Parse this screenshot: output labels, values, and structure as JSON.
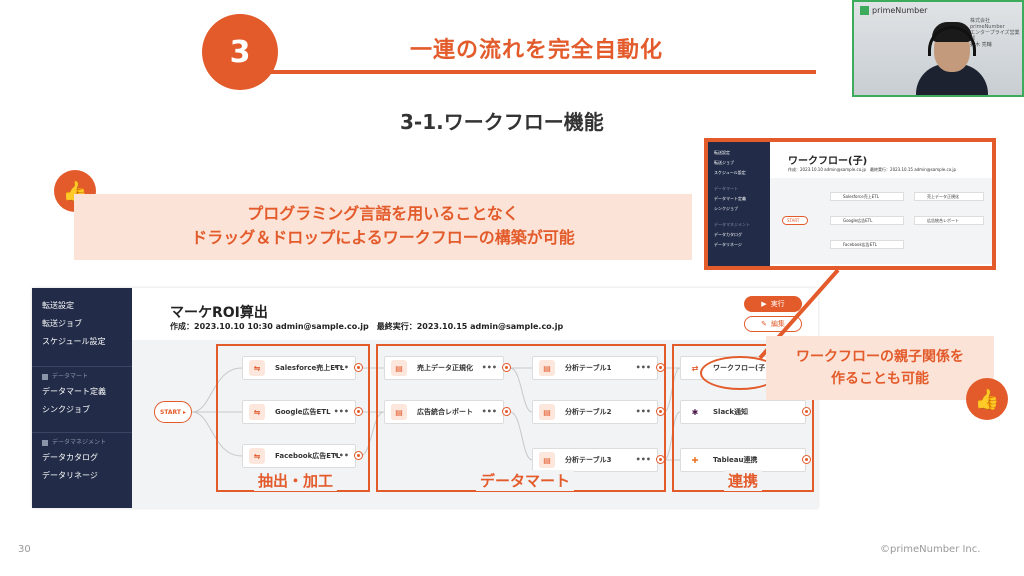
{
  "header": {
    "step_number": "3",
    "step_title": "一連の流れを完全自動化",
    "subtitle": "3-1.ワークフロー機能"
  },
  "video": {
    "logo_text": "primeNumber",
    "nametag": [
      "株式会社primeNumber",
      "エンタープライズ営業部",
      "鈴木 亮輔"
    ]
  },
  "banner": {
    "line1": "プログラミング言語を用いることなく",
    "line2": "ドラッグ＆ドロップによるワークフローの構築が可能"
  },
  "callout": {
    "line1": "ワークフローの親子関係を",
    "line2": "作ることも可能"
  },
  "preview": {
    "sidebar": [
      "転送設定",
      "転送ジョブ",
      "スケジュール設定",
      "データマート",
      "データマート定義",
      "シンクジョブ",
      "データマネジメント",
      "データカタログ",
      "データリネージ"
    ],
    "title": "ワークフロー(子)",
    "meta": "作成：2023.10.10 admin@sample.co.jp　最終実行：2023.10.15 admin@sample.co.jp",
    "start": "START",
    "nodes": [
      "Salesforce売上ETL",
      "Google広告ETL",
      "Facebook広告ETL",
      "売上データ正規化",
      "広告統合レポート"
    ]
  },
  "app": {
    "sidebar": {
      "items_top": [
        "転送設定",
        "転送ジョブ",
        "スケジュール設定"
      ],
      "group1": "データマート",
      "items_mid": [
        "データマート定義",
        "シンクジョブ"
      ],
      "group2": "データマネジメント",
      "items_bottom": [
        "データカタログ",
        "データリネージ"
      ]
    },
    "title": "マーケROI算出",
    "meta": "作成：2023.10.10 10:30 admin@sample.co.jp　最終実行：2023.10.15 admin@sample.co.jp",
    "run_label": "実行",
    "edit_label": "編集",
    "start_label": "START",
    "nodes": {
      "etl": [
        "Salesforce売上ETL",
        "Google広告ETL",
        "Facebook広告ETL"
      ],
      "mart1": [
        "売上データ正規化",
        "広告統合レポート"
      ],
      "mart2": [
        "分析テーブル1",
        "分析テーブル2",
        "分析テーブル3"
      ],
      "integration": [
        "ワークフロー(子)",
        "Slack通知",
        "Tableau連携"
      ]
    },
    "node_menu": "•••",
    "frames": {
      "extract": "抽出・加工",
      "datamart": "データマート",
      "integration": "連携"
    }
  },
  "footer": {
    "page_number": "30",
    "copyright": "©primeNumber Inc."
  },
  "colors": {
    "accent": "#e35b2b",
    "sidebar": "#222c48",
    "banner_bg": "#fbe3d8"
  }
}
